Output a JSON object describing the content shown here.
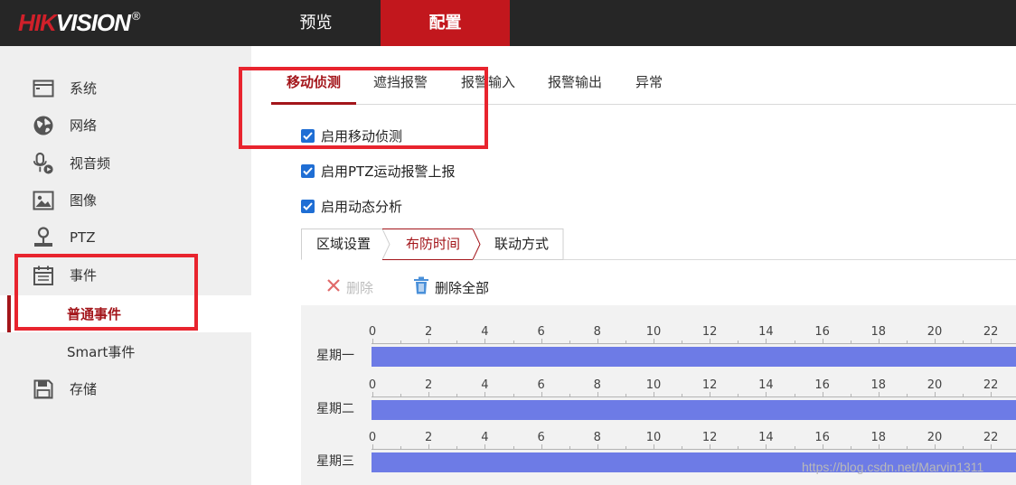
{
  "logo": {
    "hik": "HIK",
    "vision": "VISION",
    "reg": "®"
  },
  "topnav": {
    "preview": "预览",
    "config": "配置"
  },
  "sidebar": {
    "items": [
      {
        "label": "系统",
        "icon": "system-window-icon"
      },
      {
        "label": "网络",
        "icon": "globe-icon"
      },
      {
        "label": "视音频",
        "icon": "microphone-camera-icon"
      },
      {
        "label": "图像",
        "icon": "image-icon"
      },
      {
        "label": "PTZ",
        "icon": "ptz-joystick-icon"
      },
      {
        "label": "事件",
        "icon": "calendar-icon"
      },
      {
        "label": "普通事件"
      },
      {
        "label": "Smart事件"
      },
      {
        "label": "存储",
        "icon": "floppy-disk-icon"
      }
    ]
  },
  "tabs": [
    "移动侦测",
    "遮挡报警",
    "报警输入",
    "报警输出",
    "异常"
  ],
  "checkboxes": [
    {
      "label": "启用移动侦测",
      "checked": true
    },
    {
      "label": "启用PTZ运动报警上报",
      "checked": true
    },
    {
      "label": "启用动态分析",
      "checked": true
    }
  ],
  "subtabs": [
    "区域设置",
    "布防时间",
    "联动方式"
  ],
  "toolbar": {
    "delete": "删除",
    "delete_all": "删除全部"
  },
  "schedule": {
    "ticks": [
      "0",
      "2",
      "4",
      "6",
      "8",
      "10",
      "12",
      "14",
      "16",
      "18",
      "20",
      "22"
    ],
    "days": [
      "星期一",
      "星期二",
      "星期三"
    ]
  },
  "watermark": "https://blog.csdn.net/Marvin1311",
  "colors": {
    "accent": "#a3151a",
    "bar": "#6d7be6",
    "annotation": "#e8242e",
    "checkbox": "#1f6ed4"
  }
}
